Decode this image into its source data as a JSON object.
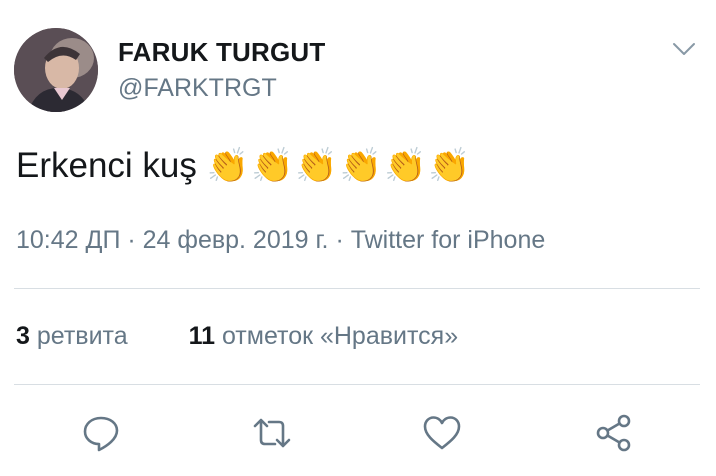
{
  "user": {
    "display_name": "FARUK TURGUT",
    "handle": "@FARKTRGT"
  },
  "tweet": {
    "text": "Erkenci kuş",
    "emoji": "👏👏👏👏👏👏"
  },
  "meta": {
    "line": "10:42 ДП · 24 февр. 2019 г. · Twitter for iPhone"
  },
  "stats": {
    "retweets_count": "3",
    "retweets_label": "ретвита",
    "likes_count": "11",
    "likes_label": "отметок «Нравится»"
  },
  "icons": {
    "caret": "chevron-down-icon",
    "reply": "reply-icon",
    "retweet": "retweet-icon",
    "like": "heart-icon",
    "share": "share-icon"
  },
  "colors": {
    "text": "#14171a",
    "secondary": "#657786",
    "divider": "#d8dee3",
    "emoji": "#f5c33b"
  }
}
